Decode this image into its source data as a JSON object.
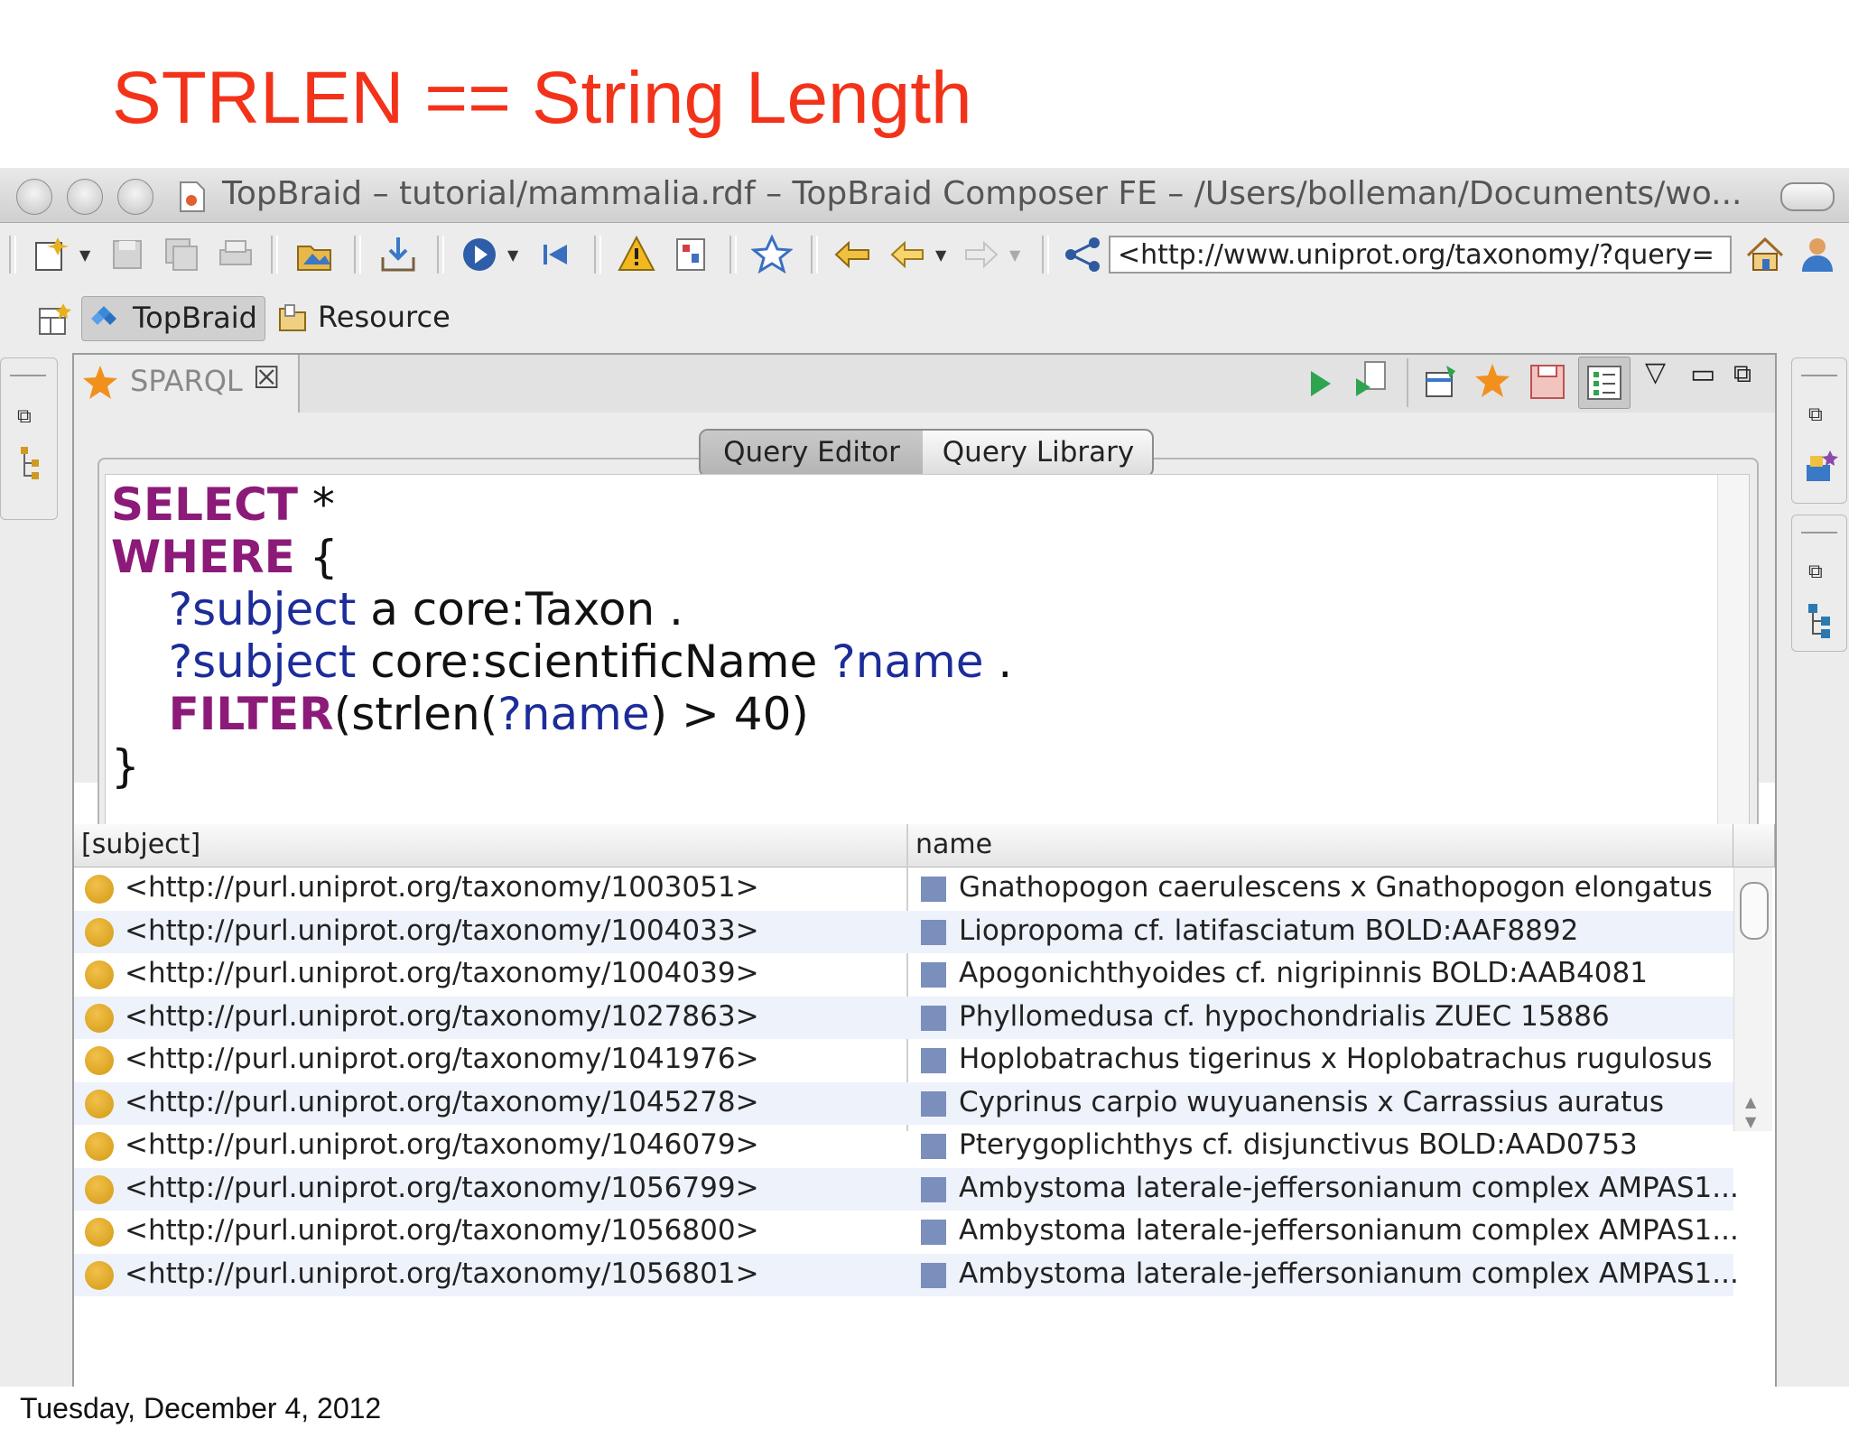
{
  "slide": {
    "title": "STRLEN == String Length",
    "date": "Tuesday, December 4, 2012"
  },
  "window": {
    "title": "TopBraid – tutorial/mammalia.rdf – TopBraid Composer FE – /Users/bolleman/Documents/wo..."
  },
  "toolbar": {
    "icons": [
      "new-icon",
      "save-icon",
      "save-all-icon",
      "print-icon",
      "open-icon",
      "import-icon",
      "run-icon",
      "first-icon",
      "warning-icon",
      "report-icon",
      "bookmark-star-icon",
      "back-nav-icon",
      "back-icon",
      "forward-icon",
      "graph-icon",
      "home-icon",
      "user-icon"
    ],
    "url": "<http://www.uniprot.org/taxonomy/?query="
  },
  "perspectives": {
    "topbraid": "TopBraid",
    "resource": "Resource"
  },
  "panel": {
    "tab_label": "SPARQL",
    "tab_close": "☒",
    "query_editor_tab": "Query Editor",
    "query_library_tab": "Query Library"
  },
  "query": {
    "line1_kw": "SELECT",
    "line1_rest": " *",
    "line2_kw": "WHERE",
    "line2_rest": " {",
    "line3_var": "?subject",
    "line3_rest": " a core:Taxon .",
    "line4_var": "?subject",
    "line4_mid": " core:scientificName ",
    "line4_var2": "?name",
    "line4_end": " .",
    "line5_kw": "FILTER",
    "line5_a": "(strlen(",
    "line5_var": "?name",
    "line5_b": ") > 40)",
    "line6": "}"
  },
  "results": {
    "columns": [
      "[subject]",
      "name"
    ],
    "rows": [
      {
        "subject": "<http://purl.uniprot.org/taxonomy/1003051>",
        "name": "Gnathopogon caerulescens x Gnathopogon elongatus"
      },
      {
        "subject": "<http://purl.uniprot.org/taxonomy/1004033>",
        "name": "Liopropoma cf. latifasciatum BOLD:AAF8892"
      },
      {
        "subject": "<http://purl.uniprot.org/taxonomy/1004039>",
        "name": "Apogonichthyoides cf. nigripinnis BOLD:AAB4081"
      },
      {
        "subject": "<http://purl.uniprot.org/taxonomy/1027863>",
        "name": "Phyllomedusa cf. hypochondrialis ZUEC 15886"
      },
      {
        "subject": "<http://purl.uniprot.org/taxonomy/1041976>",
        "name": "Hoplobatrachus tigerinus x Hoplobatrachus rugulosus"
      },
      {
        "subject": "<http://purl.uniprot.org/taxonomy/1045278>",
        "name": "Cyprinus carpio wuyuanensis x Carrassius auratus"
      },
      {
        "subject": "<http://purl.uniprot.org/taxonomy/1046079>",
        "name": "Pterygoplichthys cf. disjunctivus BOLD:AAD0753"
      },
      {
        "subject": "<http://purl.uniprot.org/taxonomy/1056799>",
        "name": "Ambystoma laterale-jeffersonianum complex AMPAS1..."
      },
      {
        "subject": "<http://purl.uniprot.org/taxonomy/1056800>",
        "name": "Ambystoma laterale-jeffersonianum complex AMPAS1..."
      },
      {
        "subject": "<http://purl.uniprot.org/taxonomy/1056801>",
        "name": "Ambystoma laterale-jeffersonianum complex AMPAS1..."
      }
    ]
  },
  "colors": {
    "title": "#f2331a",
    "keyword": "#8c1a78",
    "variable": "#1c2c99",
    "row_alt": "#eef2fb",
    "resource_dot": "#d29a14",
    "literal_square": "#7b8fbd"
  }
}
